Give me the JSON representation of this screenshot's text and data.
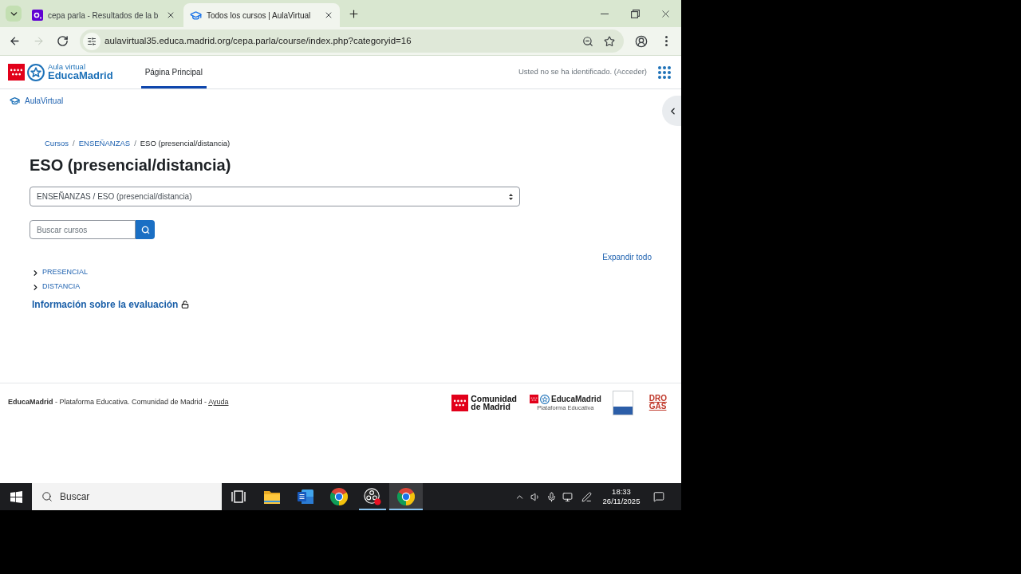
{
  "browser": {
    "tabs": [
      {
        "kind": "yahoo",
        "title": "cepa parla - Resultados de la b",
        "selected": false
      },
      {
        "kind": "cap",
        "title": "Todos los cursos | AulaVirtual",
        "selected": true
      }
    ],
    "nav_buttons": [
      {
        "kind": "back",
        "disabled": false
      },
      {
        "kind": "forward",
        "disabled": true
      },
      {
        "kind": "reload",
        "disabled": false
      }
    ],
    "url": "aulavirtual35.educa.madrid.org/cepa.parla/course/index.php?categoryid=16"
  },
  "site_header": {
    "logo_caption": "Aula virtual",
    "logo_name": "EducaMadrid",
    "nav": [
      {
        "label": "Página Principal",
        "selected": true
      }
    ],
    "login_text": "Usted no se ha identificado.",
    "login_link": "(Acceder)"
  },
  "site_link": "AulaVirtual",
  "breadcrumb": [
    {
      "label": "Cursos",
      "current": false,
      "separator": "/"
    },
    {
      "label": "ENSEÑANZAS",
      "current": false,
      "separator": "/"
    },
    {
      "label": "ESO (presencial/distancia)",
      "current": true
    }
  ],
  "title": "ESO (presencial/distancia)",
  "category_select": {
    "value": "ENSEÑANZAS / ESO (presencial/distancia)"
  },
  "course_search": {
    "placeholder": "Buscar cursos"
  },
  "expand_all": "Expandir todo",
  "categories": [
    {
      "name": "PRESENCIAL",
      "expanded": false
    },
    {
      "name": "DISTANCIA",
      "expanded": false
    }
  ],
  "courses": [
    {
      "name": "Información sobre la evaluación",
      "guest_access": true
    }
  ],
  "footer": {
    "text": "**EducaMadrid** - Plataforma Educativa. Comunidad de Madrid - ",
    "link": "Ayuda",
    "logos": [
      {
        "kind": "comunidad",
        "lines": [
          "Comunidad",
          "de Madrid"
        ]
      },
      {
        "kind": "educamadrid",
        "name": "EducaMadrid",
        "caption": "Plataforma Educativa"
      },
      {
        "kind": "badge"
      },
      {
        "kind": "drogas",
        "lines": [
          "DRO",
          "GAS"
        ]
      }
    ]
  },
  "taskbar": {
    "search_placeholder": "Buscar",
    "apps": [
      {
        "kind": "task_view",
        "running": false,
        "selected": false
      },
      {
        "kind": "explorer",
        "running": false,
        "selected": false
      },
      {
        "kind": "word",
        "running": false,
        "selected": false
      },
      {
        "kind": "chrome",
        "running": false,
        "selected": false
      },
      {
        "kind": "obs",
        "running": true,
        "selected": false
      },
      {
        "kind": "chrome",
        "running": true,
        "selected": true
      }
    ],
    "time": "18:33",
    "date": "26/11/2025"
  }
}
